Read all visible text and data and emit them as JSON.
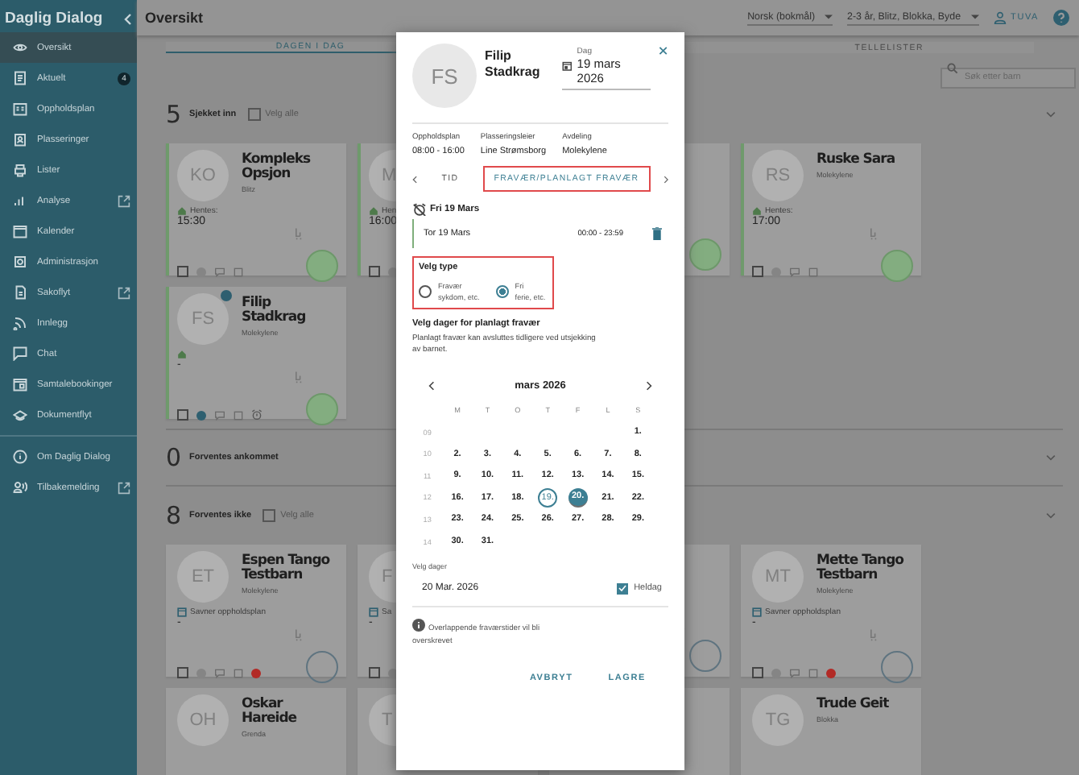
{
  "sidebar": {
    "title": "Daglig Dialog",
    "items": [
      {
        "label": "Oversikt",
        "selected": true,
        "external": false
      },
      {
        "label": "Aktuelt",
        "selected": false,
        "external": false,
        "badge": "4"
      },
      {
        "label": "Oppholdsplan",
        "selected": false,
        "external": false
      },
      {
        "label": "Plasseringer",
        "selected": false,
        "external": false
      },
      {
        "label": "Lister",
        "selected": false,
        "external": false
      },
      {
        "label": "Analyse",
        "selected": false,
        "external": true
      },
      {
        "label": "Kalender",
        "selected": false,
        "external": false
      },
      {
        "label": "Administrasjon",
        "selected": false,
        "external": false
      },
      {
        "label": "Sakoflyt",
        "selected": false,
        "external": true
      },
      {
        "label": "Innlegg",
        "selected": false,
        "external": false
      },
      {
        "label": "Chat",
        "selected": false,
        "external": false
      },
      {
        "label": "Samtalebookinger",
        "selected": false,
        "external": false
      },
      {
        "label": "Dokumentflyt",
        "selected": false,
        "external": false
      }
    ],
    "footer_items": [
      {
        "label": "Om Daglig Dialog",
        "selected": false,
        "external": false
      },
      {
        "label": "Tilbakemelding",
        "selected": false,
        "external": true
      }
    ]
  },
  "topbar": {
    "title": "Oversikt",
    "language": "Norsk (bokmål)",
    "groups": "2-3 år, Blitz, Blokka, Byde",
    "user": "TUVA"
  },
  "tabs": [
    {
      "label": "DAGEN I DAG",
      "selected": true
    },
    {
      "label": "TELLELISTER",
      "selected": false
    }
  ],
  "search": {
    "placeholder": "Søk etter barn"
  },
  "sections": [
    {
      "count": "5",
      "title": "Sjekket inn",
      "select_all": "Velg alle",
      "select_all_checked": false,
      "cards": [
        {
          "kind": "full",
          "initials": "KO",
          "name": "Kompleks Opsjon",
          "group": "Blitz",
          "missing_plan": false,
          "status_label": "Hentes:",
          "time": "15:30",
          "checked_in": true,
          "info": false,
          "clock_active": false,
          "alarm": false,
          "alert": false
        },
        {
          "kind": "partial",
          "initials": "M",
          "missing_plan": false,
          "status_label": "Hen",
          "time": "16:00",
          "checked_in": true,
          "clock_active": false
        },
        {
          "kind": "edge",
          "checked_in": true
        },
        {
          "kind": "full",
          "initials": "RS",
          "name": "Ruske Sara",
          "group": "Molekylene",
          "missing_plan": false,
          "status_label": "Hentes:",
          "time": "17:00",
          "checked_in": true,
          "info": false,
          "clock_active": false,
          "alarm": false,
          "alert": false
        },
        {
          "kind": "full",
          "initials": "FS",
          "name": "Filip Stadkrag",
          "group": "Molekylene",
          "missing_plan": false,
          "time": "-",
          "checked_in": true,
          "info": true,
          "clock_active": true,
          "alarm": true,
          "alert": false
        }
      ]
    },
    {
      "count": "0",
      "title": "Forventes ankommet"
    },
    {
      "count": "8",
      "title": "Forventes ikke",
      "select_all": "Velg alle",
      "select_all_checked": false,
      "cards": [
        {
          "kind": "full",
          "initials": "ET",
          "name": "Espen Tango Testbarn",
          "group": "Molekylene",
          "missing_plan": true,
          "status_label": "Savner oppholdsplan",
          "time": "-",
          "checked_in": false,
          "info": false,
          "clock_active": false,
          "alarm": false,
          "alert": true
        },
        {
          "kind": "partial",
          "initials": "F",
          "missing_plan": true,
          "status_label": "Sa",
          "time": "-",
          "checked_in": false,
          "clock_active": false
        },
        {
          "kind": "edge",
          "checked_in": false
        },
        {
          "kind": "full",
          "initials": "MT",
          "name": "Mette Tango Testbarn",
          "group": "Molekylene",
          "missing_plan": true,
          "status_label": "Savner oppholdsplan",
          "time": "-",
          "checked_in": false,
          "info": false,
          "clock_active": false,
          "alarm": false,
          "alert": true
        },
        {
          "kind": "full",
          "initials": "OH",
          "name": "Oskar Hareide",
          "group": "Grenda"
        },
        {
          "kind": "partial",
          "initials": "T"
        },
        {
          "kind": "edge"
        },
        {
          "kind": "full",
          "initials": "TG",
          "name": "Trude Geit",
          "group": "Blokka"
        }
      ]
    }
  ],
  "dialog": {
    "initials": "FS",
    "name": "Filip Stadkrag",
    "date_label": "Dag",
    "date": "19 mars 2026",
    "info": [
      {
        "label": "Oppholdsplan",
        "value": "08:00 - 16:00"
      },
      {
        "label": "Plasseringsleier",
        "value": "Line Strømsborg"
      },
      {
        "label": "Avdeling",
        "value": "Molekylene"
      }
    ],
    "tabs": [
      {
        "label": "TID",
        "selected": false,
        "highlighted": false
      },
      {
        "label": "FRAVÆR/PLANLAGT FRAVÆR",
        "selected": true,
        "highlighted": true
      }
    ],
    "absence": {
      "title": "Fri 19 Mars",
      "entries": [
        {
          "day": "Tor 19 Mars",
          "time": "00:00 - 23:59"
        }
      ]
    },
    "type_section": {
      "title": "Velg type",
      "highlighted": true,
      "options": [
        {
          "label": "Fravær",
          "hint": "sykdom, etc.",
          "selected": false
        },
        {
          "label": "Fri",
          "hint": "ferie, etc.",
          "selected": true
        }
      ]
    },
    "planned": {
      "title": "Velg dager for planlagt fravær",
      "text": "Planlagt fravær kan avsluttes tidligere ved utsjekking av barnet."
    },
    "calendar": {
      "month": "mars 2026",
      "weekdays": [
        "M",
        "T",
        "O",
        "T",
        "F",
        "L",
        "S"
      ],
      "weeks": [
        {
          "number": "09",
          "days": [
            {
              "label": "1.",
              "today": false,
              "selected": false
            }
          ]
        },
        {
          "number": "10",
          "days": [
            {
              "label": "2.",
              "today": false,
              "selected": false
            },
            {
              "label": "3.",
              "today": false,
              "selected": false
            },
            {
              "label": "4.",
              "today": false,
              "selected": false
            },
            {
              "label": "5.",
              "today": false,
              "selected": false
            },
            {
              "label": "6.",
              "today": false,
              "selected": false
            },
            {
              "label": "7.",
              "today": false,
              "selected": false
            },
            {
              "label": "8.",
              "today": false,
              "selected": false
            }
          ]
        },
        {
          "number": "11",
          "days": [
            {
              "label": "9.",
              "today": false,
              "selected": false
            },
            {
              "label": "10.",
              "today": false,
              "selected": false
            },
            {
              "label": "11.",
              "today": false,
              "selected": false
            },
            {
              "label": "12.",
              "today": false,
              "selected": false
            },
            {
              "label": "13.",
              "today": false,
              "selected": false
            },
            {
              "label": "14.",
              "today": false,
              "selected": false
            },
            {
              "label": "15.",
              "today": false,
              "selected": false
            }
          ]
        },
        {
          "number": "12",
          "days": [
            {
              "label": "16.",
              "today": false,
              "selected": false
            },
            {
              "label": "17.",
              "today": false,
              "selected": false
            },
            {
              "label": "18.",
              "today": false,
              "selected": false
            },
            {
              "label": "19.",
              "today": true,
              "selected": false
            },
            {
              "label": "20.",
              "today": false,
              "selected": true
            },
            {
              "label": "21.",
              "today": false,
              "selected": false
            },
            {
              "label": "22.",
              "today": false,
              "selected": false
            }
          ]
        },
        {
          "number": "13",
          "days": [
            {
              "label": "23.",
              "today": false,
              "selected": false
            },
            {
              "label": "24.",
              "today": false,
              "selected": false
            },
            {
              "label": "25.",
              "today": false,
              "selected": false
            },
            {
              "label": "26.",
              "today": false,
              "selected": false
            },
            {
              "label": "27.",
              "today": false,
              "selected": false
            },
            {
              "label": "28.",
              "today": false,
              "selected": false
            },
            {
              "label": "29.",
              "today": false,
              "selected": false
            }
          ]
        },
        {
          "number": "14",
          "days": [
            {
              "label": "30.",
              "today": false,
              "selected": false
            },
            {
              "label": "31.",
              "today": false,
              "selected": false
            }
          ]
        }
      ]
    },
    "days_field": {
      "label": "Velg dager",
      "value": "20 Mar. 2026",
      "allday_label": "Heldag",
      "allday": true
    },
    "notice": "Overlappende fraværstider vil bli overskrevet",
    "buttons": [
      "AVBRYT",
      "LAGRE"
    ]
  }
}
